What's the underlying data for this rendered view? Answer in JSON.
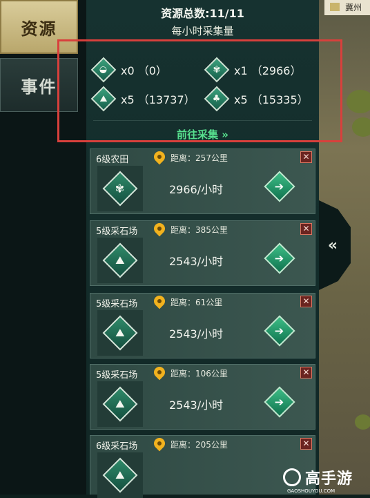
{
  "tabs": [
    {
      "label": "资源",
      "active": true
    },
    {
      "label": "事件",
      "active": false
    }
  ],
  "header": {
    "total": "资源总数:11/11",
    "hourly_title": "每小时采集量"
  },
  "hourly_resources": [
    {
      "icon": "silver-ingot-icon",
      "glyph": "◒",
      "text": "x0  （0）"
    },
    {
      "icon": "grain-icon",
      "glyph": "✾",
      "text": "x1  （2966）"
    },
    {
      "icon": "stone-icon",
      "glyph": "⛰",
      "text": "x5  （13737）"
    },
    {
      "icon": "wood-icon",
      "glyph": "♣",
      "text": "x5  （15335）"
    }
  ],
  "goto_label": "前往采集 »",
  "cards": [
    {
      "name": "6级农田",
      "distance": "距离：257公里",
      "rate": "2966/小时",
      "icon": "grain-icon",
      "glyph": "✾"
    },
    {
      "name": "5级采石场",
      "distance": "距离：385公里",
      "rate": "2543/小时",
      "icon": "stone-icon",
      "glyph": "⛰"
    },
    {
      "name": "5级采石场",
      "distance": "距离：61公里",
      "rate": "2543/小时",
      "icon": "stone-icon",
      "glyph": "⛰"
    },
    {
      "name": "5级采石场",
      "distance": "距离：106公里",
      "rate": "2543/小时",
      "icon": "stone-icon",
      "glyph": "⛰"
    },
    {
      "name": "6级采石场",
      "distance": "距离：205公里",
      "rate": "",
      "icon": "stone-icon",
      "glyph": "⛰"
    }
  ],
  "close_glyph": "✕",
  "go_glyph": "➔",
  "map": {
    "location": "冀州"
  },
  "collapse_glyph": "«",
  "watermark": {
    "brand": "高手游",
    "url": "GAOSHOUYOU.COM"
  },
  "colors": {
    "highlight": "#d8403c",
    "accent_green": "#57e08e",
    "active_tab": "#d9cc9a"
  }
}
